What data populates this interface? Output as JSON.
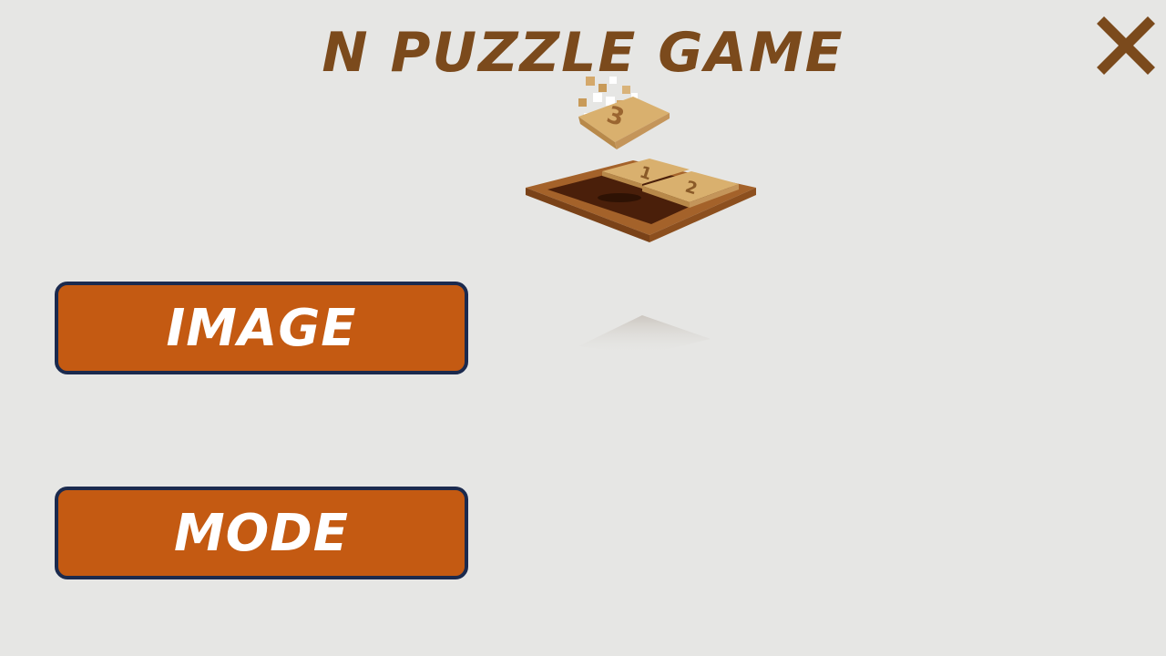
{
  "title": "N PUZZLE GAME",
  "menu": {
    "image_label": "IMAGE",
    "mode_label": "MODE"
  },
  "logo": {
    "tiles": [
      "1",
      "2",
      "3"
    ]
  },
  "icons": {
    "close": "close-icon"
  },
  "colors": {
    "background": "#e6e6e4",
    "title": "#7b4a1c",
    "button_fill": "#c45a12",
    "button_border": "#1b2a4e",
    "button_text": "#ffffff",
    "close_icon": "#7b4a1c"
  }
}
